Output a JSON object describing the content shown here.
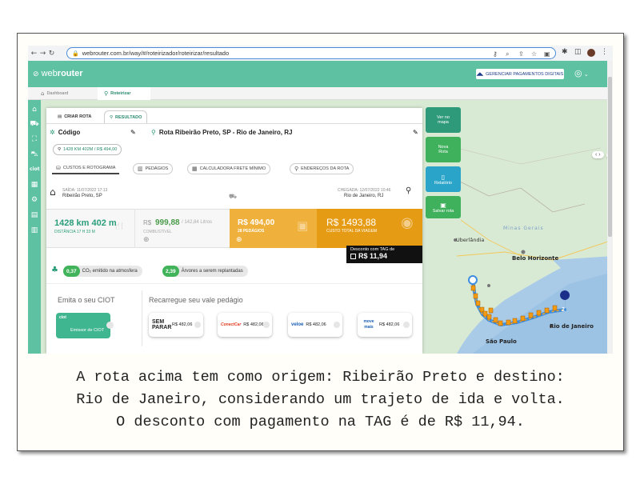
{
  "browser": {
    "url": "webrouter.com.br/way/#/roteirizador/roteirizar/resultado"
  },
  "app": {
    "logo_light": "web",
    "logo_bold": "router",
    "manage_button": "GERENCIAR PAGAMENTOS DIGITAIS",
    "tabs": [
      {
        "label": "Dashboard"
      },
      {
        "label": "Roteirizar"
      }
    ]
  },
  "panel": {
    "tab_create": "CRIAR ROTA",
    "tab_result": "RESULTADO",
    "code_label": "Código",
    "route_title": "Rota Ribeirão Preto, SP - Rio de Janeiro, RJ",
    "summary_pill": "1428 KM 402M / R$ 494,00",
    "subtabs": [
      "CUSTOS E ROTOGRAMA",
      "PEDÁGIOS",
      "CALCULADORA FRETE MÍNIMO",
      "ENDEREÇOS DA ROTA"
    ],
    "departure_label": "SAÍDA: 11/07/2022 17:13",
    "departure_city": "Ribeirão Preto, SP",
    "arrival_label": "CHEGADA: 12/07/2022 10:46",
    "arrival_city": "Rio de Janeiro, RJ",
    "distance_value": "1428 km 402 m",
    "distance_label": "DISTÂNCIA 17 H 33 M",
    "fuel_currency": "R$",
    "fuel_value": "999,88",
    "fuel_liters": "/ 142,84 Litros",
    "fuel_label": "COMBUSTÍVEL",
    "toll_value": "R$ 494,00",
    "toll_label": "28 PEDÁGIOS",
    "total_value": "R$ 1493,88",
    "total_label": "CUSTO TOTAL DA VIAGEM",
    "tag_discount_label": "Desconto com TAG de",
    "tag_discount_value": "R$ 11,94",
    "co2_value": "0,37",
    "co2_label": "CO₂ emitido na atmosfera",
    "trees_value": "2,39",
    "trees_label": "Árvores a serem replantadas",
    "ciot_title": "Emita o seu CIOT",
    "ciot_card_tag": "ciot",
    "ciot_card_label": "Emissor de CIOT",
    "recharge_title": "Recarregue seu vale pedágio",
    "vouchers": [
      {
        "brand": "SEM PARAR",
        "value": "R$ 482,06"
      },
      {
        "brand": "ConectCar",
        "value": "R$ 482,06"
      },
      {
        "brand": "veloe",
        "value": "R$ 482,06"
      },
      {
        "brand": "move mais",
        "value": "R$ 482,06"
      }
    ]
  },
  "actions": {
    "view_map": "Ver no mapa",
    "new_route": "Nova Rota",
    "reports": "Relatório",
    "save_route": "Salvar rota"
  },
  "map": {
    "labels": [
      "Belo Horizonte",
      "Rio de Janeiro",
      "São Paulo",
      "Minas Gerais",
      "Uberlândia"
    ],
    "end_marker": "2"
  },
  "caption": {
    "line1": "A rota acima tem como origem: Ribeirão Preto e destino:",
    "line2": "Rio de Janeiro, considerando um trajeto de ida e volta.",
    "line3": "O desconto com pagamento na TAG é de R$ 11,94."
  },
  "colors": {
    "brand_green": "#5ec1a2",
    "toll_orange": "#f0b13c",
    "total_orange": "#e69b14",
    "action_green": "#3fb05c",
    "action_teal": "#2aa5c9"
  }
}
